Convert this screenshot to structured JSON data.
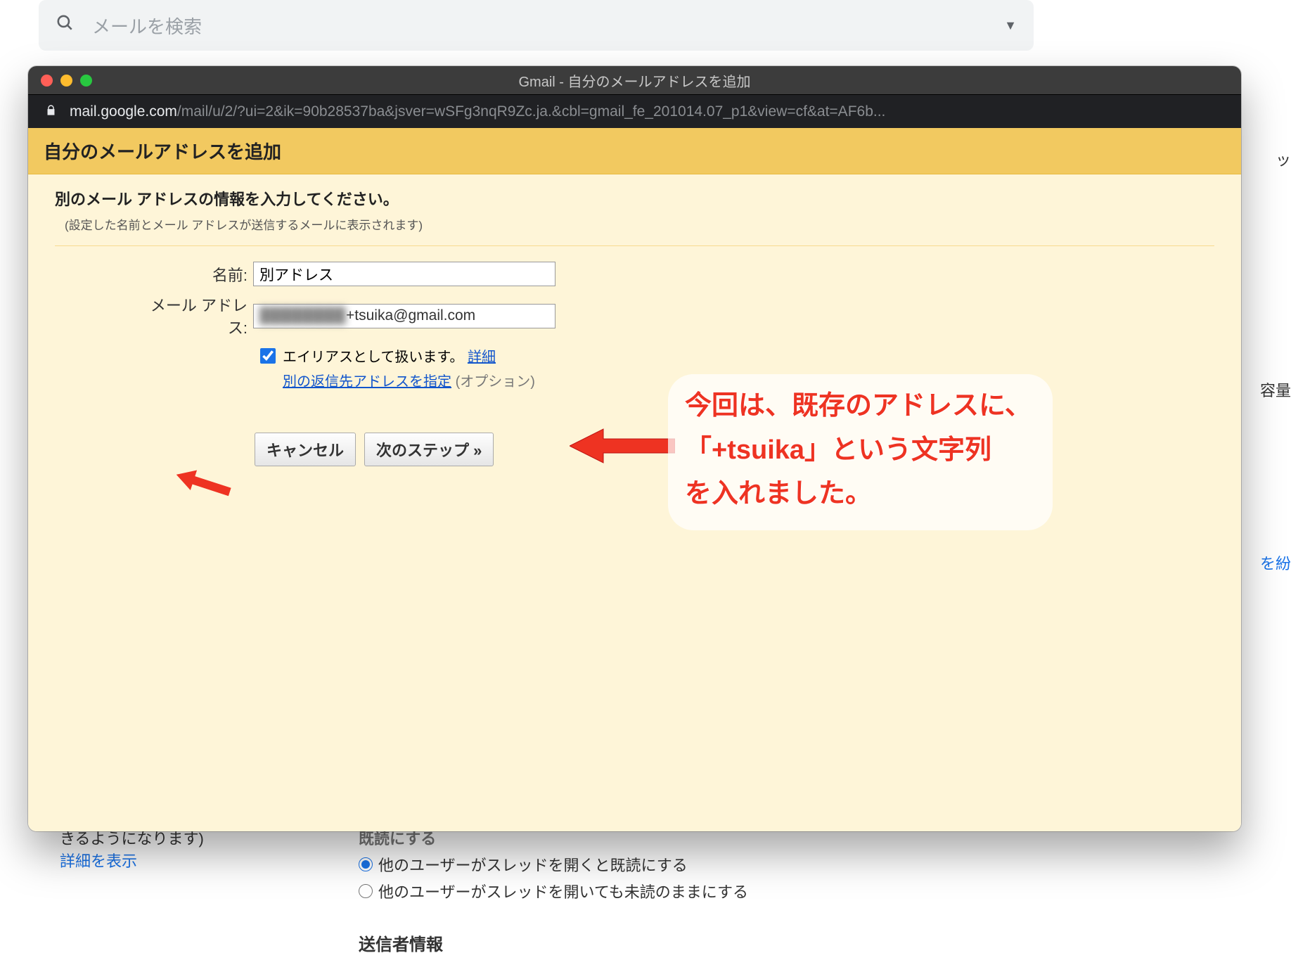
{
  "search": {
    "placeholder": "メールを検索"
  },
  "bg_right": {
    "a": "ッ",
    "b": "容量",
    "c": "を紛"
  },
  "bg_below": {
    "tail": "きるようになります)",
    "show_details": "詳細を表示",
    "section_read": "既読にする",
    "radio1": "他のユーザーがスレッドを開くと既読にする",
    "radio2": "他のユーザーがスレッドを開いても未読のままにする",
    "sender_info": "送信者情報"
  },
  "window": {
    "title": "Gmail - 自分のメールアドレスを追加",
    "url_host": "mail.google.com",
    "url_path": "/mail/u/2/?ui=2&ik=90b28537ba&jsver=wSFg3nqR9Zc.ja.&cbl=gmail_fe_201014.07_p1&view=cf&at=AF6b..."
  },
  "dialog": {
    "header": "自分のメールアドレスを追加",
    "lead": "別のメール アドレスの情報を入力してください。",
    "sublead": "(設定した名前とメール アドレスが送信するメールに表示されます)",
    "name_label": "名前:",
    "name_value": "別アドレス",
    "addr_label": "メール アドレス:",
    "addr_obscured": "████████",
    "addr_suffix": "+tsuika@gmail.com",
    "alias_label": "エイリアスとして扱います。",
    "alias_more": "詳細",
    "reply_link": "別の返信先アドレスを指定",
    "reply_note": "(オプション)",
    "btn_cancel": "キャンセル",
    "btn_next": "次のステップ »"
  },
  "annotation": {
    "l1": "今回は、既存のアドレスに、",
    "l2": "「+tsuika」という文字列",
    "l3": "を入れました。"
  }
}
